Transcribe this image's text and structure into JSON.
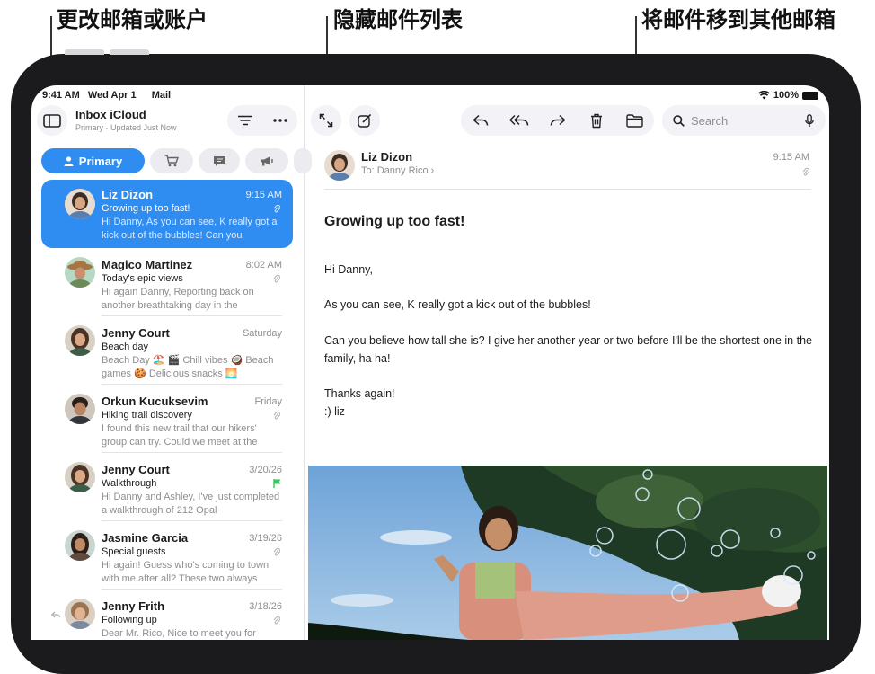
{
  "callouts": {
    "left": "更改邮箱或账户",
    "middle": "隐藏邮件列表",
    "right": "将邮件移到其他邮箱"
  },
  "status_bar": {
    "time": "9:41 AM",
    "date": "Wed Apr 1",
    "app": "Mail",
    "battery": "100%"
  },
  "mailbox": {
    "title": "Inbox iCloud",
    "subtitle": "Primary · Updated Just Now"
  },
  "categories": [
    {
      "label": "Primary",
      "icon": "person-icon",
      "active": true
    },
    {
      "label": "",
      "icon": "cart-icon"
    },
    {
      "label": "",
      "icon": "chat-icon"
    },
    {
      "label": "",
      "icon": "megaphone-icon"
    }
  ],
  "messages": [
    {
      "sender": "Liz Dizon",
      "time": "9:15 AM",
      "subject": "Growing up too fast!",
      "preview": "Hi Danny, As you can see, K really got a kick out of the bubbles! Can you",
      "selected": true,
      "attachment": true
    },
    {
      "sender": "Magico Martinez",
      "time": "8:02 AM",
      "subject": "Today's epic views",
      "preview": "Hi again Danny, Reporting back on another breathtaking day in the",
      "attachment": true
    },
    {
      "sender": "Jenny Court",
      "time": "Saturday",
      "subject": "Beach day",
      "preview": "Beach Day 🏖️ 🎬 Chill vibes 🥥 Beach games 🍪 Delicious snacks 🌅"
    },
    {
      "sender": "Orkun Kucuksevim",
      "time": "Friday",
      "subject": "Hiking trail discovery",
      "preview": "I found this new trail that our hikers' group can try. Could we meet at the",
      "attachment": true
    },
    {
      "sender": "Jenny Court",
      "time": "3/20/26",
      "subject": "Walkthrough",
      "preview": "Hi Danny and Ashley, I've just completed a walkthrough of 212 Opal",
      "flag": true
    },
    {
      "sender": "Jasmine Garcia",
      "time": "3/19/26",
      "subject": "Special guests",
      "preview": "Hi again! Guess who's coming to town with me after all? These two always",
      "attachment": true
    },
    {
      "sender": "Jenny Frith",
      "time": "3/18/26",
      "subject": "Following up",
      "preview": "Dear Mr. Rico, Nice to meet you for",
      "replied": true,
      "attachment": true
    }
  ],
  "toolbar": {
    "search_placeholder": "Search"
  },
  "email": {
    "from": "Liz Dizon",
    "to_label": "To:",
    "to": "Danny Rico",
    "time": "9:15 AM",
    "subject": "Growing up too fast!",
    "greeting": "Hi Danny,",
    "p1": "As you can see, K really got a kick out of the bubbles!",
    "p2": "Can you believe how tall she is? I give her another year or two before I'll be the shortest one in the family, ha ha!",
    "p3": "Thanks again!",
    "signoff": ":) liz"
  },
  "colors": {
    "accent": "#2f8cf0",
    "flag": "#34c759"
  }
}
